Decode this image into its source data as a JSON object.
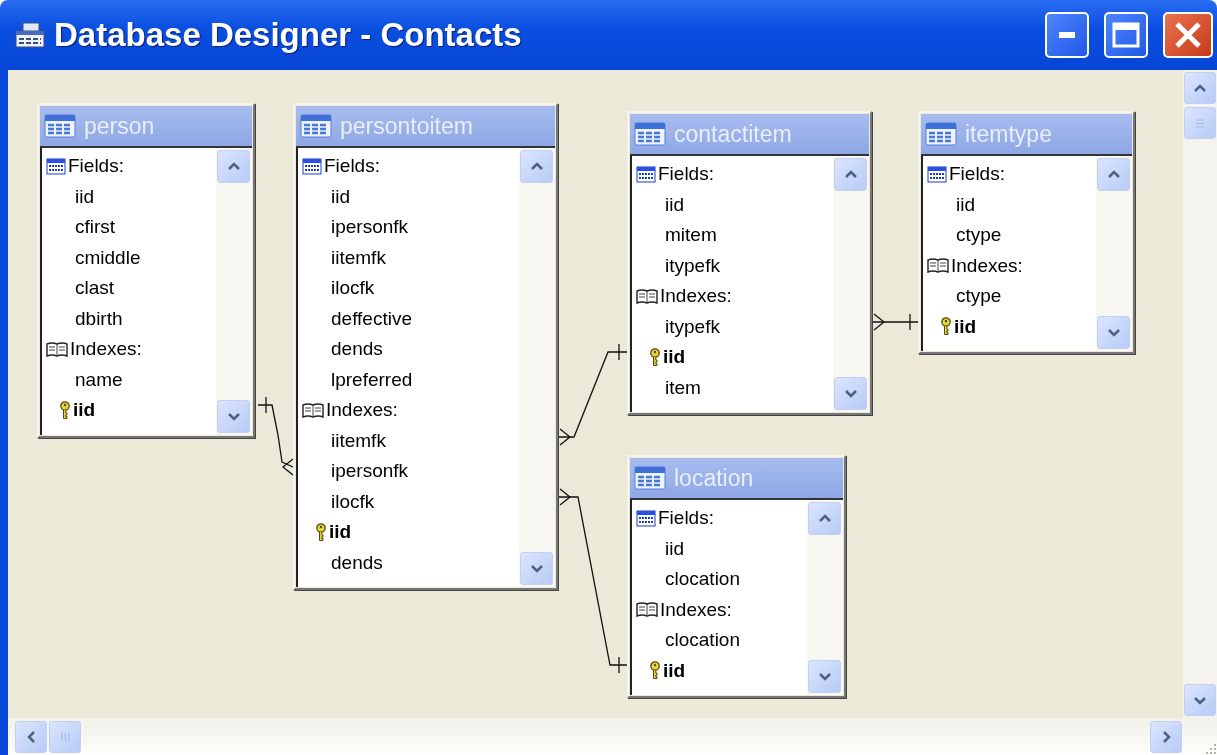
{
  "window": {
    "title": "Database Designer - Contacts"
  },
  "tables": [
    {
      "name": "person",
      "rows": [
        {
          "kind": "fields_header",
          "text": "Fields:"
        },
        {
          "kind": "field",
          "text": "iid"
        },
        {
          "kind": "field",
          "text": "cfirst"
        },
        {
          "kind": "field",
          "text": "cmiddle"
        },
        {
          "kind": "field",
          "text": "clast"
        },
        {
          "kind": "field",
          "text": "dbirth"
        },
        {
          "kind": "indexes_header",
          "text": "Indexes:"
        },
        {
          "kind": "field",
          "text": "name"
        },
        {
          "kind": "key",
          "text": "iid"
        }
      ]
    },
    {
      "name": "persontoitem",
      "rows": [
        {
          "kind": "fields_header",
          "text": "Fields:"
        },
        {
          "kind": "field",
          "text": "iid"
        },
        {
          "kind": "field",
          "text": "ipersonfk"
        },
        {
          "kind": "field",
          "text": "iitemfk"
        },
        {
          "kind": "field",
          "text": "ilocfk"
        },
        {
          "kind": "field",
          "text": "deffective"
        },
        {
          "kind": "field",
          "text": "dends"
        },
        {
          "kind": "field",
          "text": "lpreferred"
        },
        {
          "kind": "indexes_header",
          "text": "Indexes:"
        },
        {
          "kind": "field",
          "text": "iitemfk"
        },
        {
          "kind": "field",
          "text": "ipersonfk"
        },
        {
          "kind": "field",
          "text": "ilocfk"
        },
        {
          "kind": "key",
          "text": "iid"
        },
        {
          "kind": "field",
          "text": "dends"
        }
      ]
    },
    {
      "name": "contactitem",
      "rows": [
        {
          "kind": "fields_header",
          "text": "Fields:"
        },
        {
          "kind": "field",
          "text": "iid"
        },
        {
          "kind": "field",
          "text": "mitem"
        },
        {
          "kind": "field",
          "text": "itypefk"
        },
        {
          "kind": "indexes_header",
          "text": "Indexes:"
        },
        {
          "kind": "field",
          "text": "itypefk"
        },
        {
          "kind": "key",
          "text": "iid"
        },
        {
          "kind": "field",
          "text": "item"
        }
      ]
    },
    {
      "name": "itemtype",
      "rows": [
        {
          "kind": "fields_header",
          "text": "Fields:"
        },
        {
          "kind": "field",
          "text": "iid"
        },
        {
          "kind": "field",
          "text": "ctype"
        },
        {
          "kind": "indexes_header",
          "text": "Indexes:"
        },
        {
          "kind": "field",
          "text": "ctype"
        },
        {
          "kind": "key",
          "text": "iid"
        }
      ]
    },
    {
      "name": "location",
      "rows": [
        {
          "kind": "fields_header",
          "text": "Fields:"
        },
        {
          "kind": "field",
          "text": "iid"
        },
        {
          "kind": "field",
          "text": "clocation"
        },
        {
          "kind": "indexes_header",
          "text": "Indexes:"
        },
        {
          "kind": "field",
          "text": "clocation"
        },
        {
          "kind": "key",
          "text": "iid"
        }
      ]
    }
  ]
}
